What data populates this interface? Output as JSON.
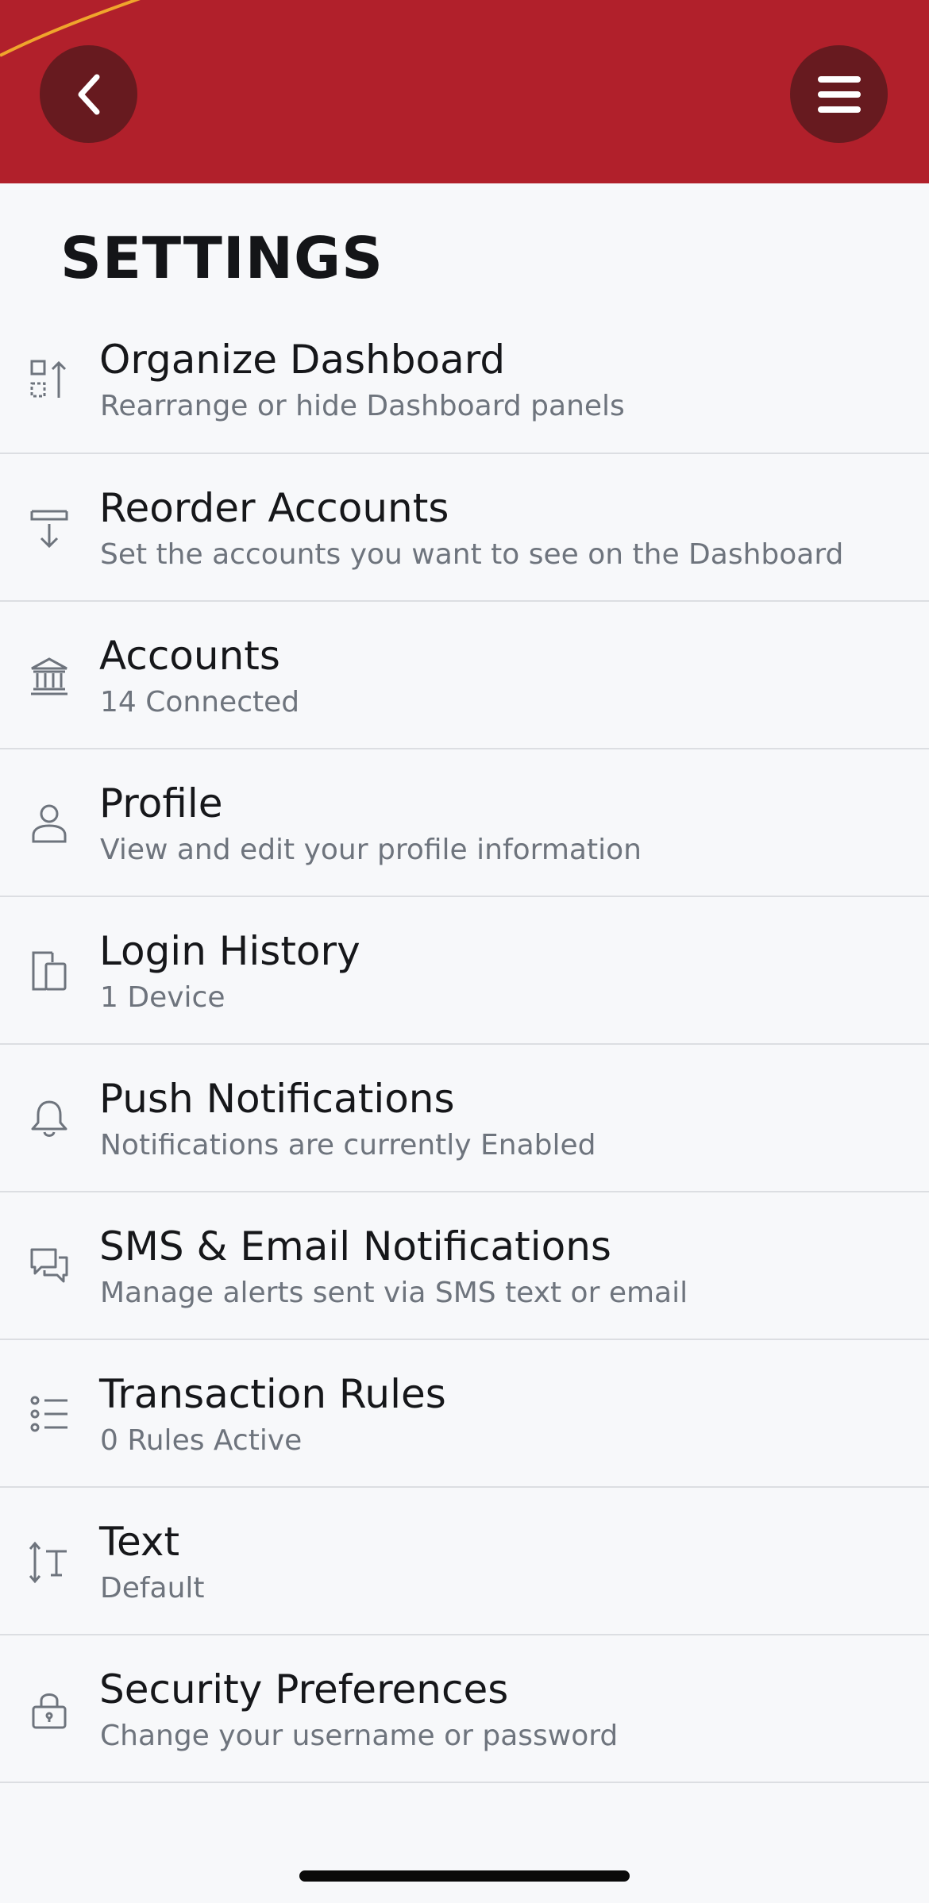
{
  "colors": {
    "header_background": "#b1202b",
    "header_button_background": "#671a1f",
    "header_accent_stripe": "#f0a52c",
    "page_background": "#f7f8fa",
    "divider": "#dcdee2",
    "title_text": "#141518",
    "subtitle_text": "#6e747d",
    "icon_stroke": "#6e747d"
  },
  "header": {
    "back_icon": "chevron-left-icon",
    "menu_icon": "hamburger-menu-icon"
  },
  "page": {
    "title": "SETTINGS"
  },
  "settings": {
    "items": [
      {
        "icon": "organize-dashboard-icon",
        "title": "Organize Dashboard",
        "subtitle": "Rearrange or hide Dashboard panels"
      },
      {
        "icon": "reorder-download-icon",
        "title": "Reorder Accounts",
        "subtitle": "Set the accounts you want to see on the Dashboard"
      },
      {
        "icon": "bank-icon",
        "title": "Accounts",
        "subtitle": "14 Connected"
      },
      {
        "icon": "user-icon",
        "title": "Profile",
        "subtitle": "View and edit your profile information"
      },
      {
        "icon": "devices-icon",
        "title": "Login History",
        "subtitle": "1 Device"
      },
      {
        "icon": "bell-icon",
        "title": "Push Notifications",
        "subtitle": "Notifications are currently Enabled"
      },
      {
        "icon": "chat-bubbles-icon",
        "title": "SMS & Email Notifications",
        "subtitle": "Manage alerts sent via SMS text or email"
      },
      {
        "icon": "list-icon",
        "title": "Transaction Rules",
        "subtitle": "0 Rules Active"
      },
      {
        "icon": "text-size-icon",
        "title": "Text",
        "subtitle": "Default"
      },
      {
        "icon": "lock-icon",
        "title": "Security Preferences",
        "subtitle": "Change your username or password"
      }
    ]
  }
}
